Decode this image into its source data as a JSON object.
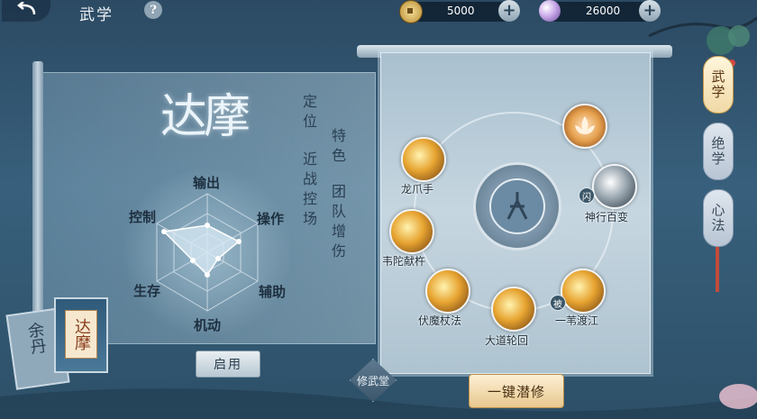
{
  "header": {
    "title": "武学",
    "help_label": "?"
  },
  "resources": [
    {
      "icon": "copper-coin-icon",
      "value": "5000"
    },
    {
      "icon": "spirit-pearl-icon",
      "value": "26000"
    }
  ],
  "character": {
    "name": "达摩",
    "role_label": "定位",
    "role_value": "近战控场",
    "trait_label": "特色",
    "trait_value": "团队增伤",
    "stats": [
      "输出",
      "操作",
      "辅助",
      "机动",
      "生存",
      "控制"
    ],
    "enable_label": "启用",
    "cards": [
      {
        "label": "达摩",
        "active": true
      },
      {
        "label": "余丹",
        "active": false
      }
    ]
  },
  "skills": [
    {
      "name": "龙爪手",
      "tag": ""
    },
    {
      "name": "韦陀献杵",
      "tag": ""
    },
    {
      "name": "伏魔杖法",
      "tag": ""
    },
    {
      "name": "大道轮回",
      "tag": ""
    },
    {
      "name": "一苇渡江",
      "tag": "被"
    },
    {
      "name": "神行百变",
      "tag": "闪"
    },
    {
      "name": "",
      "tag": ""
    }
  ],
  "buttons": {
    "train_all": "一键潜修",
    "training_hall": "修武堂"
  },
  "side_tabs": [
    {
      "label": "武学",
      "active": true
    },
    {
      "label": "绝学",
      "active": false
    },
    {
      "label": "心法",
      "active": false
    }
  ]
}
